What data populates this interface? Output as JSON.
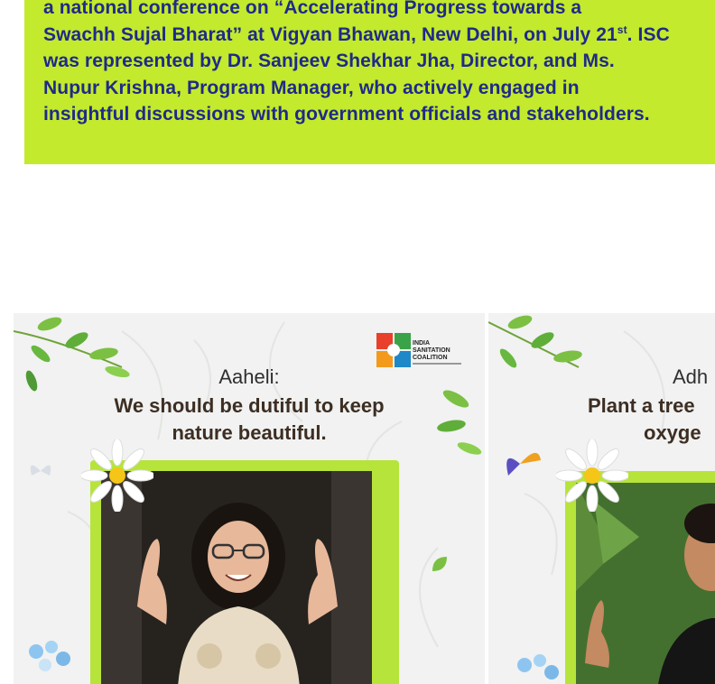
{
  "announcement": {
    "line1": "a national conference on  “Accelerating Progress towards a",
    "line2_pre": "Swachh Sujal Bharat” at Vigyan Bhawan, New Delhi, on July 21",
    "line2_sup": "st",
    "line2_post": ". ISC",
    "line3": "was represented by Dr. Sanjeev Shekhar Jha, Director, and Ms.",
    "line4": "Nupur Krishna, Program Manager, who actively engaged in",
    "line5": "insightful discussions with government officials and stakeholders."
  },
  "posts": [
    {
      "name": "Aaheli:",
      "quote_line1": "We should be dutiful to keep",
      "quote_line2": "nature beautiful.",
      "logo_text": "INDIA SANITATION COALITION"
    },
    {
      "name": "Adh",
      "quote_line1": "Plant a tree",
      "quote_line2": "oxyge"
    }
  ],
  "colors": {
    "card_green": "#c3ea2c",
    "text_blue": "#1f2a8a",
    "frame_green": "#b6e43a"
  }
}
